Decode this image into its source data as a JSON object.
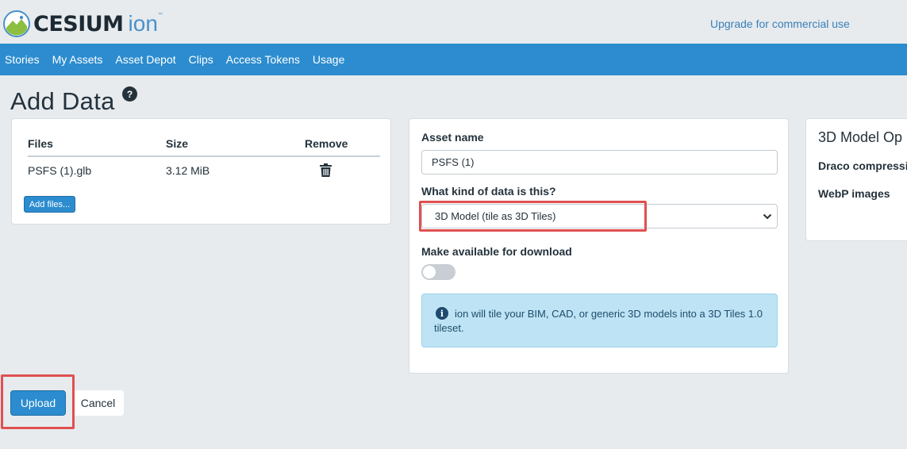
{
  "header": {
    "logo_text": "CESIUM",
    "logo_ion": "ion",
    "logo_tm": "™",
    "upgrade_link": "Upgrade for commercial use"
  },
  "nav": {
    "items": [
      {
        "label": "Stories"
      },
      {
        "label": "My Assets"
      },
      {
        "label": "Asset Depot"
      },
      {
        "label": "Clips"
      },
      {
        "label": "Access Tokens"
      },
      {
        "label": "Usage"
      }
    ]
  },
  "page": {
    "title": "Add Data",
    "help_icon": "?"
  },
  "files_panel": {
    "headers": {
      "files": "Files",
      "size": "Size",
      "remove": "Remove"
    },
    "rows": [
      {
        "name": "PSFS (1).glb",
        "size": "3.12 MiB",
        "remove_icon": "trash-icon"
      }
    ],
    "add_files_label": "Add files..."
  },
  "asset_panel": {
    "asset_name_label": "Asset name",
    "asset_name_value": "PSFS (1)",
    "data_kind_label": "What kind of data is this?",
    "data_kind_value": "3D Model (tile as 3D Tiles)",
    "download_label": "Make available for download",
    "download_enabled": false,
    "info_icon": "i",
    "info_text": "ion will tile your BIM, CAD, or generic 3D models into a 3D Tiles 1.0 tileset."
  },
  "options_panel": {
    "title": "3D Model Op",
    "draco_label": "Draco compressi",
    "webp_label": "WebP images"
  },
  "actions": {
    "upload_label": "Upload",
    "cancel_label": "Cancel"
  },
  "colors": {
    "accent": "#2c8ccf",
    "highlight": "#e05050",
    "info_bg": "#bde3f5"
  }
}
